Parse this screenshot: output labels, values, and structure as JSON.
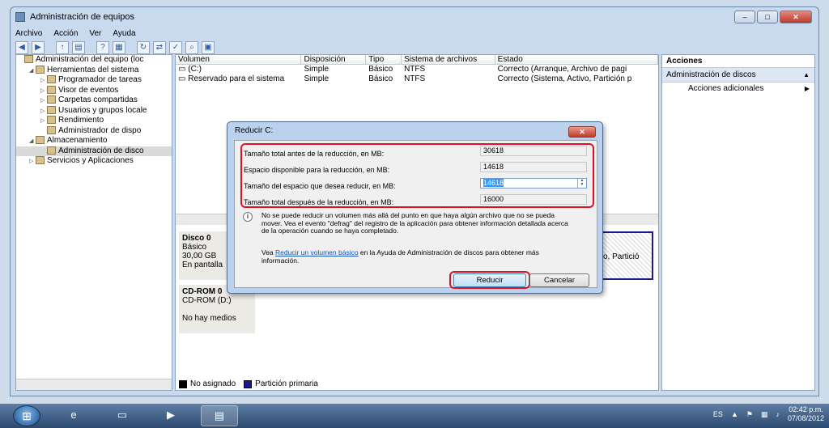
{
  "window": {
    "title": "Administración de equipos",
    "caption_min": "–",
    "caption_max": "□",
    "caption_close": "✕"
  },
  "menu": [
    "Archivo",
    "Acción",
    "Ver",
    "Ayuda"
  ],
  "toolbar_icons": [
    "back-icon",
    "forward-icon",
    "up-folder-icon",
    "show-hide-tree-icon",
    "help-icon",
    "properties-icon",
    "refresh-icon",
    "connect-icon",
    "check-icon",
    "format-icon"
  ],
  "tree": {
    "items": [
      {
        "label": "Administración del equipo (loc",
        "level": 0,
        "arrow": "",
        "icon": "computer-management-icon"
      },
      {
        "label": "Herramientas del sistema",
        "level": 1,
        "arrow": "◢",
        "icon": "tools-icon"
      },
      {
        "label": "Programador de tareas",
        "level": 2,
        "arrow": "▷",
        "icon": "clock-icon"
      },
      {
        "label": "Visor de eventos",
        "level": 2,
        "arrow": "▷",
        "icon": "event-viewer-icon"
      },
      {
        "label": "Carpetas compartidas",
        "level": 2,
        "arrow": "▷",
        "icon": "shared-folder-icon"
      },
      {
        "label": "Usuarios y grupos locale",
        "level": 2,
        "arrow": "▷",
        "icon": "users-icon"
      },
      {
        "label": "Rendimiento",
        "level": 2,
        "arrow": "▷",
        "icon": "performance-icon"
      },
      {
        "label": "Administrador de dispo",
        "level": 2,
        "arrow": "",
        "icon": "device-manager-icon"
      },
      {
        "label": "Almacenamiento",
        "level": 1,
        "arrow": "◢",
        "icon": "storage-icon"
      },
      {
        "label": "Administración de disco",
        "level": 2,
        "arrow": "",
        "icon": "disk-management-icon",
        "selected": true
      },
      {
        "label": "Servicios y Aplicaciones",
        "level": 1,
        "arrow": "▷",
        "icon": "services-icon"
      }
    ]
  },
  "volumes": {
    "headers": [
      "Volumen",
      "Disposición",
      "Tipo",
      "Sistema de archivos",
      "Estado"
    ],
    "rows": [
      [
        "(C:)",
        "Simple",
        "Básico",
        "NTFS",
        "Correcto (Arranque, Archivo de pagi"
      ],
      [
        "Reservado para el sistema",
        "Simple",
        "Básico",
        "NTFS",
        "Correcto (Sistema, Activo, Partición p"
      ]
    ]
  },
  "disks": {
    "disk0": {
      "name": "Disco 0",
      "type": "Básico",
      "size": "30,00 GB",
      "status": "En pantalla",
      "partition_text": "o, Partició"
    },
    "cdrom": {
      "name": "CD-ROM 0",
      "type": "CD-ROM (D:)",
      "status": "No hay medios"
    },
    "legend": [
      {
        "label": "No asignado",
        "color": "#000000"
      },
      {
        "label": "Partición primaria",
        "color": "#1a1a8a"
      }
    ]
  },
  "actions": {
    "header": "Acciones",
    "section": "Administración de discos",
    "item": "Acciones adicionales"
  },
  "dialog": {
    "title": "Reducir C:",
    "close": "✕",
    "fields": [
      {
        "label": "Tamaño total antes de la reducción, en MB:",
        "value": "30618"
      },
      {
        "label": "Espacio disponible para la reducción, en MB:",
        "value": "14618"
      },
      {
        "label": "Tamaño del espacio que desea reducir, en MB:",
        "value": "14618"
      },
      {
        "label": "Tamaño total después de la reducción, en MB:",
        "value": "16000"
      }
    ],
    "info_text": "No se puede reducir un volumen más allá del punto en que haya algún archivo que no se pueda mover. Vea el evento \"defrag\" del registro de la aplicación para obtener información detallada acerca de la operación cuando se haya completado.",
    "help_prefix": "Vea ",
    "help_link": "Reducir un volumen básico",
    "help_suffix": " en la Ayuda de Administración de discos para obtener más información.",
    "ok": "Reducir",
    "cancel": "Cancelar"
  },
  "taskbar": {
    "lang": "ES",
    "time": "02:42 p.m.",
    "date": "07/08/2012"
  }
}
